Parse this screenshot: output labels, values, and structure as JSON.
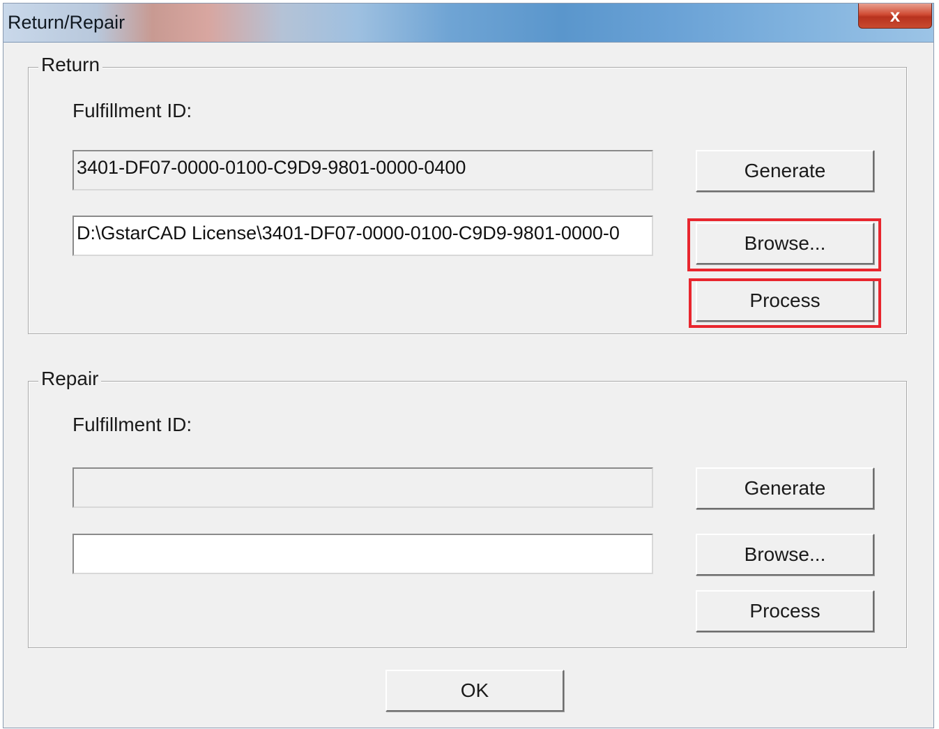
{
  "window": {
    "title": "Return/Repair",
    "close_glyph": "x"
  },
  "return_group": {
    "legend": "Return",
    "fulfillment_label": "Fulfillment ID:",
    "fulfillment_id_value": "3401-DF07-0000-0100-C9D9-9801-0000-0400",
    "file_path_value": "D:\\GstarCAD License\\3401-DF07-0000-0100-C9D9-9801-0000-0",
    "generate_label": "Generate",
    "browse_label": "Browse...",
    "process_label": "Process"
  },
  "repair_group": {
    "legend": "Repair",
    "fulfillment_label": "Fulfillment ID:",
    "fulfillment_id_value": "",
    "file_path_value": "",
    "generate_label": "Generate",
    "browse_label": "Browse...",
    "process_label": "Process"
  },
  "ok_label": "OK",
  "colors": {
    "highlight": "#e8262e",
    "dialog_bg": "#f0f0f0"
  }
}
